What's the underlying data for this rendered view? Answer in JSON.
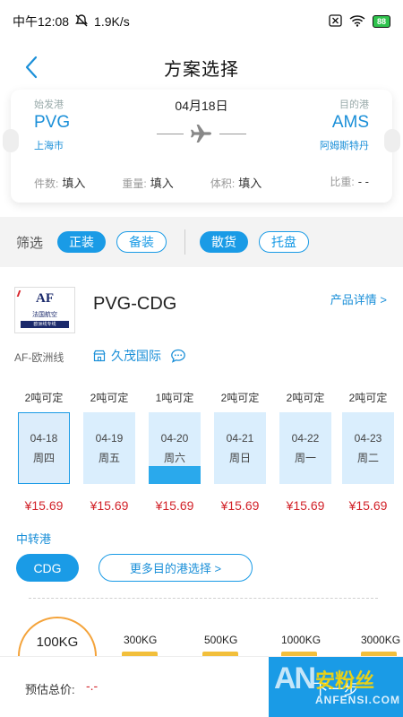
{
  "status_bar": {
    "time": "中午12:08",
    "speed": "1.9K/s",
    "battery": "88"
  },
  "nav": {
    "title": "方案选择"
  },
  "route": {
    "origin_label": "始发港",
    "origin_code": "PVG",
    "origin_city": "上海市",
    "date": "04月18日",
    "dest_label": "目的港",
    "dest_code": "AMS",
    "dest_city": "阿姆斯特丹",
    "metrics": [
      {
        "label": "件数:",
        "value": "填入"
      },
      {
        "label": "重量:",
        "value": "填入"
      },
      {
        "label": "体积:",
        "value": "填入"
      },
      {
        "label": "比重:",
        "value": "- -"
      }
    ]
  },
  "filters": {
    "label": "筛选",
    "options": [
      {
        "label": "正装",
        "active": true
      },
      {
        "label": "备装",
        "active": false
      },
      {
        "label": "散货",
        "active": true
      },
      {
        "label": "托盘",
        "active": false
      }
    ]
  },
  "airline": {
    "logo_text": "AF",
    "logo_sub": "法国航空",
    "logo_band": "欧洲线专线",
    "route_name": "PVG-CDG",
    "detail_link": "产品详情 >",
    "line_name": "AF-欧洲线",
    "agent": "久茂国际"
  },
  "days": [
    {
      "cap": "2吨可定",
      "date": "04-18",
      "weekday": "周四",
      "selected": true,
      "level": 0
    },
    {
      "cap": "2吨可定",
      "date": "04-19",
      "weekday": "周五",
      "selected": false,
      "level": 0
    },
    {
      "cap": "1吨可定",
      "date": "04-20",
      "weekday": "周六",
      "selected": false,
      "level": 0.25
    },
    {
      "cap": "2吨可定",
      "date": "04-21",
      "weekday": "周日",
      "selected": false,
      "level": 0
    },
    {
      "cap": "2吨可定",
      "date": "04-22",
      "weekday": "周一",
      "selected": false,
      "level": 0
    },
    {
      "cap": "2吨可定",
      "date": "04-23",
      "weekday": "周二",
      "selected": false,
      "level": 0
    }
  ],
  "prices": [
    "¥15.69",
    "¥15.69",
    "¥15.69",
    "¥15.69",
    "¥15.69",
    "¥15.69"
  ],
  "transfer": {
    "label": "中转港",
    "selected": "CDG",
    "more": "更多目的港选择 >"
  },
  "weights": {
    "selected": "100KG",
    "options": [
      "300KG",
      "500KG",
      "1000KG",
      "3000KG"
    ]
  },
  "bottom": {
    "total_label": "预估总价:",
    "total_value": "-.-",
    "next_label": "下一步"
  },
  "watermark": {
    "big": "AN",
    "cn": "安粉丝",
    "en": "ANFENSI.COM"
  },
  "colors": {
    "accent": "#1a9be6",
    "price_red": "#d2232a",
    "weight_ring": "#f4a33a"
  }
}
